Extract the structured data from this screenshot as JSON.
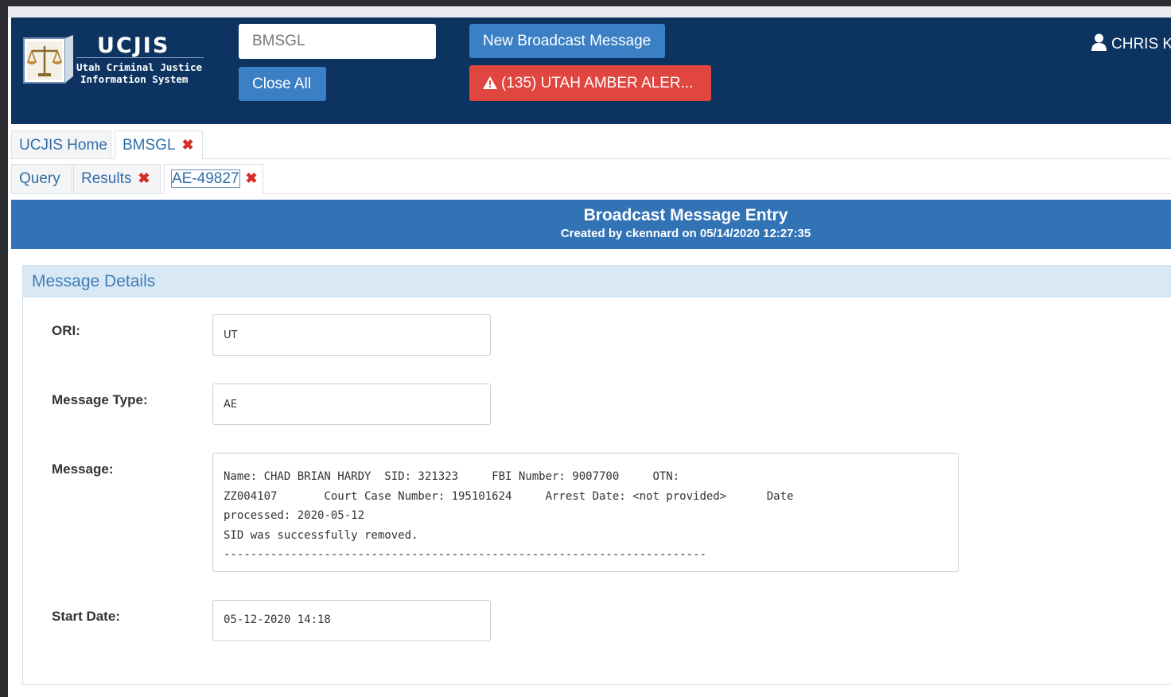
{
  "header": {
    "logo_title": "UCJIS",
    "logo_subtitle_line1": "Utah Criminal Justice",
    "logo_subtitle_line2": "Information System",
    "search_value": "BMSGL",
    "close_all_label": "Close All",
    "new_broadcast_label": "New Broadcast Message",
    "amber_alert_label": "(135) UTAH AMBER ALER...",
    "user_name": "CHRIS KI"
  },
  "tabs_primary": [
    {
      "label": "UCJIS Home",
      "closable": false
    },
    {
      "label": "BMSGL",
      "closable": true
    }
  ],
  "tabs_secondary": [
    {
      "label": "Query",
      "closable": false
    },
    {
      "label": "Results",
      "closable": true
    },
    {
      "label": "AE-49827",
      "closable": true
    }
  ],
  "close_glyph": "✖",
  "banner": {
    "title": "Broadcast Message Entry",
    "subtitle": "Created by ckennard on 05/14/2020 12:27:35"
  },
  "panel": {
    "title": "Message Details",
    "ori_label": "ORI:",
    "ori_value": "UT",
    "type_label": "Message Type:",
    "type_value": "AE",
    "message_label": "Message:",
    "message_lines": [
      "Name: CHAD BRIAN HARDY  SID: 321323     FBI Number: 9007700     OTN:",
      "ZZ004107       Court Case Number: 195101624     Arrest Date: <not provided>      Date",
      "processed: 2020-05-12",
      "SID was successfully removed.",
      "------------------------------------------------------------------------"
    ],
    "start_label": "Start Date:",
    "start_value": "05-12-2020 14:18"
  },
  "colors": {
    "header_bg": "#0d3361",
    "button_blue": "#3b7fc4",
    "alert_red": "#e0463f",
    "banner_blue": "#3273b6",
    "panel_head_bg": "#d8e9f5",
    "close_red": "#d72b2b"
  },
  "icons": {
    "logo": "justice-scales-icon",
    "alert": "warning-triangle-icon",
    "user": "user-icon",
    "close": "close-x-icon"
  }
}
